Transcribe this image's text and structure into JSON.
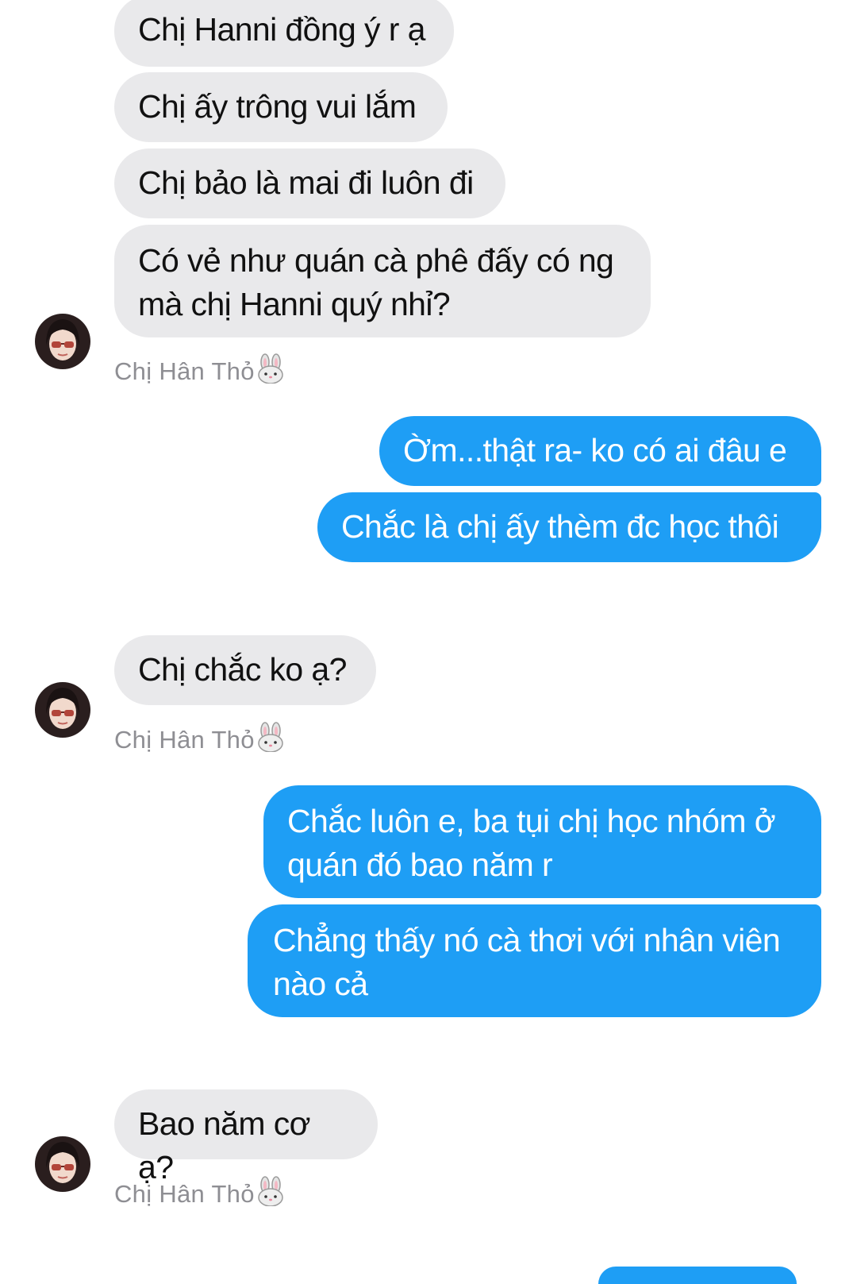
{
  "conversation": {
    "contact_name": "Chị Hân Thỏ",
    "contact_emoji": "bunny-face-icon",
    "colors": {
      "incoming_bubble": "#e9e9eb",
      "outgoing_bubble": "#1e9ef5",
      "incoming_text": "#111111",
      "outgoing_text": "#ffffff",
      "sender_label": "#8e8e93"
    },
    "messages": [
      {
        "direction": "incoming",
        "text": "Chị Hanni đồng ý r ạ"
      },
      {
        "direction": "incoming",
        "text": "Chị ấy trông vui lắm"
      },
      {
        "direction": "incoming",
        "text": "Chị bảo là mai đi luôn đi"
      },
      {
        "direction": "incoming",
        "text": "Có vẻ như quán cà phê đấy có ng\nmà chị Hanni quý nhỉ?"
      },
      {
        "direction": "outgoing",
        "text": "Ờm...thật ra- ko có ai đâu e"
      },
      {
        "direction": "outgoing",
        "text": "Chắc là chị ấy thèm đc học thôi"
      },
      {
        "direction": "incoming",
        "text": "Chị chắc ko ạ?"
      },
      {
        "direction": "outgoing",
        "text": "Chắc luôn e, ba tụi chị học nhóm ở\nquán đó bao năm r"
      },
      {
        "direction": "outgoing",
        "text": "Chẳng thấy nó cà thơi với nhân viên\nnào cả"
      },
      {
        "direction": "incoming",
        "text": "Bao năm cơ ạ?"
      }
    ]
  }
}
